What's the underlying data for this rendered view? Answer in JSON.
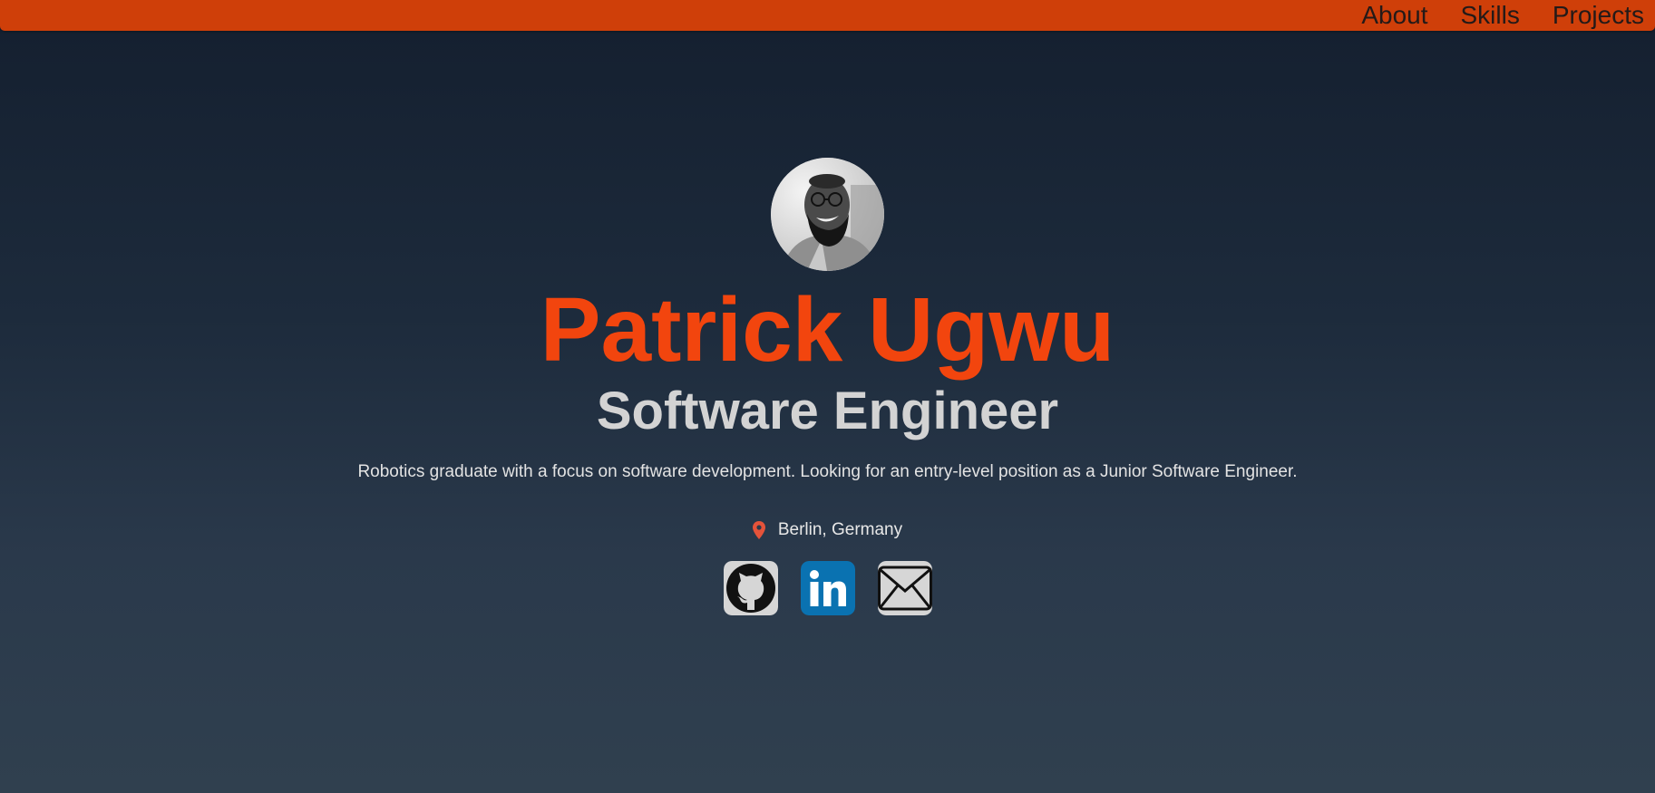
{
  "nav": {
    "items": [
      {
        "label": "About"
      },
      {
        "label": "Skills"
      },
      {
        "label": "Projects"
      }
    ]
  },
  "profile": {
    "avatar_icon": "profile-photo",
    "name": "Patrick Ugwu",
    "role": "Software Engineer",
    "summary": "Robotics graduate with a focus on software development. Looking for an entry-level position as a Junior Software Engineer.",
    "location": "Berlin, Germany"
  },
  "social": [
    {
      "icon": "github-icon"
    },
    {
      "icon": "linkedin-icon"
    },
    {
      "icon": "email-icon"
    }
  ],
  "colors": {
    "topbar": "#cf3f09",
    "name": "#f2450e",
    "role": "#d3d3d3",
    "pin": "#e5533a",
    "linkedin": "#0a72b1"
  }
}
